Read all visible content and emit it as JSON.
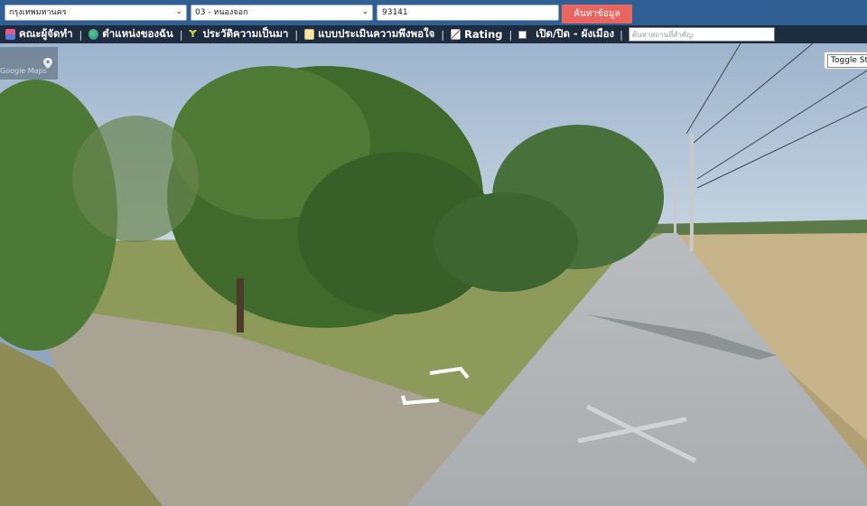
{
  "search": {
    "province": "กรุงเทพมหานคร",
    "district": "03 - หนองจอก",
    "code_value": "93141",
    "button_label": "ค้นหาข้อมูล"
  },
  "nav": {
    "items": [
      {
        "label": "คณะผู้จัดทำ",
        "icon": "book-icon"
      },
      {
        "label": "ตำแหน่งของฉัน",
        "icon": "globe-icon"
      },
      {
        "label": "ประวัติความเป็นมา",
        "icon": "sprout-icon"
      },
      {
        "label": "แบบประเมินความพึงพอใจ",
        "icon": "note-icon"
      },
      {
        "label": "Rating",
        "icon": "chart-icon"
      }
    ],
    "toggle_label": "เปิด/ปิด - ผังเมือง",
    "place_search_placeholder": "ค้นหาสถานที่สำคัญ"
  },
  "map": {
    "google_label": "Google Maps",
    "toggle_button": "Toggle St"
  },
  "colors": {
    "topbar": "#2f5f93",
    "navbar": "#1d2c3f",
    "search_button": "#e8665f"
  }
}
